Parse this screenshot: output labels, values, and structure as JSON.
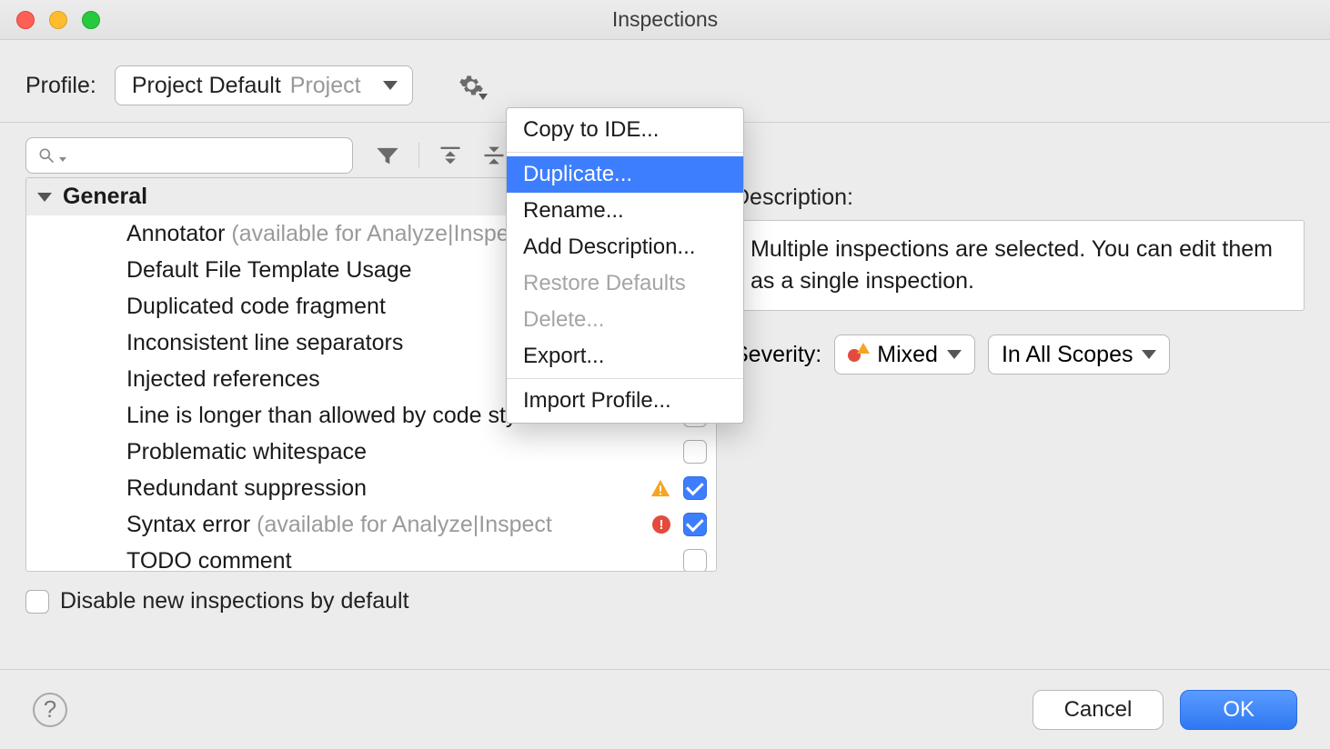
{
  "window": {
    "title": "Inspections"
  },
  "profile": {
    "label": "Profile:",
    "value": "Project Default",
    "scope": "Project"
  },
  "gear_menu": {
    "items": [
      {
        "label": "Copy to IDE...",
        "enabled": true,
        "selected": false
      },
      {
        "label": "Duplicate...",
        "enabled": true,
        "selected": true
      },
      {
        "label": "Rename...",
        "enabled": true,
        "selected": false
      },
      {
        "label": "Add Description...",
        "enabled": true,
        "selected": false
      },
      {
        "label": "Restore Defaults",
        "enabled": false,
        "selected": false
      },
      {
        "label": "Delete...",
        "enabled": false,
        "selected": false
      },
      {
        "label": "Export...",
        "enabled": true,
        "selected": false
      },
      {
        "label": "Import Profile...",
        "enabled": true,
        "selected": false
      }
    ]
  },
  "search": {
    "placeholder": ""
  },
  "tree": {
    "group": "General",
    "items": [
      {
        "label": "Annotator",
        "hint": " (available for Analyze|Inspect Code)",
        "severity": null,
        "checkbox": "unchecked_hidden"
      },
      {
        "label": "Default File Template Usage",
        "hint": "",
        "severity": null,
        "checkbox": "unchecked_hidden"
      },
      {
        "label": "Duplicated code fragment",
        "hint": "",
        "severity": null,
        "checkbox": "unchecked_hidden"
      },
      {
        "label": "Inconsistent line separators",
        "hint": "",
        "severity": null,
        "checkbox": "unchecked_hidden"
      },
      {
        "label": "Injected references",
        "hint": "",
        "severity": null,
        "checkbox": "unchecked_hidden"
      },
      {
        "label": "Line is longer than allowed by code style",
        "hint": "",
        "severity": null,
        "checkbox": "unchecked"
      },
      {
        "label": "Problematic whitespace",
        "hint": "",
        "severity": null,
        "checkbox": "unchecked"
      },
      {
        "label": "Redundant suppression",
        "hint": "",
        "severity": "warning",
        "checkbox": "checked"
      },
      {
        "label": "Syntax error",
        "hint": " (available for Analyze|Inspect",
        "severity": "error",
        "checkbox": "checked"
      },
      {
        "label": "TODO comment",
        "hint": "",
        "severity": null,
        "checkbox": "unchecked"
      }
    ]
  },
  "disable_checkbox": {
    "label": "Disable new inspections by default",
    "checked": false
  },
  "right": {
    "description_label": "Description:",
    "description_text": "Multiple inspections are selected. You can edit them as a single inspection.",
    "severity_label": "Severity:",
    "severity_value": "Mixed",
    "scope_value": "In All Scopes"
  },
  "footer": {
    "cancel": "Cancel",
    "ok": "OK"
  }
}
